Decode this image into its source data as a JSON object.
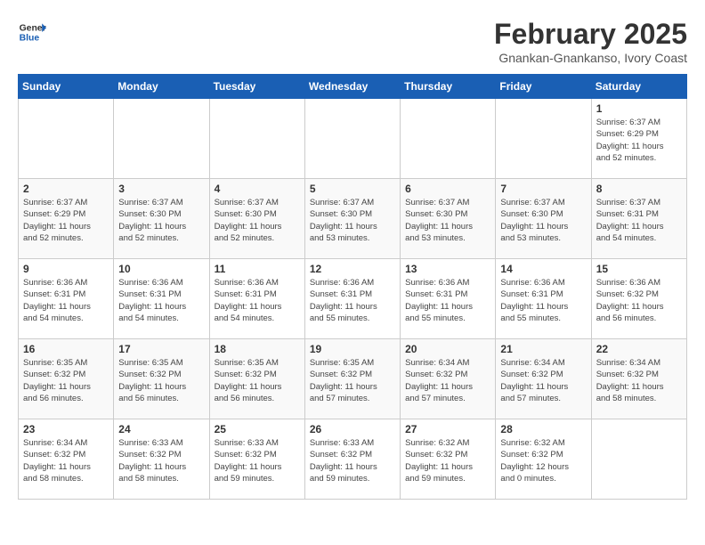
{
  "header": {
    "logo_line1": "General",
    "logo_line2": "Blue",
    "month": "February 2025",
    "location": "Gnankan-Gnankanso, Ivory Coast"
  },
  "days_of_week": [
    "Sunday",
    "Monday",
    "Tuesday",
    "Wednesday",
    "Thursday",
    "Friday",
    "Saturday"
  ],
  "weeks": [
    [
      {
        "day": "",
        "info": ""
      },
      {
        "day": "",
        "info": ""
      },
      {
        "day": "",
        "info": ""
      },
      {
        "day": "",
        "info": ""
      },
      {
        "day": "",
        "info": ""
      },
      {
        "day": "",
        "info": ""
      },
      {
        "day": "1",
        "info": "Sunrise: 6:37 AM\nSunset: 6:29 PM\nDaylight: 11 hours\nand 52 minutes."
      }
    ],
    [
      {
        "day": "2",
        "info": "Sunrise: 6:37 AM\nSunset: 6:29 PM\nDaylight: 11 hours\nand 52 minutes."
      },
      {
        "day": "3",
        "info": "Sunrise: 6:37 AM\nSunset: 6:30 PM\nDaylight: 11 hours\nand 52 minutes."
      },
      {
        "day": "4",
        "info": "Sunrise: 6:37 AM\nSunset: 6:30 PM\nDaylight: 11 hours\nand 52 minutes."
      },
      {
        "day": "5",
        "info": "Sunrise: 6:37 AM\nSunset: 6:30 PM\nDaylight: 11 hours\nand 53 minutes."
      },
      {
        "day": "6",
        "info": "Sunrise: 6:37 AM\nSunset: 6:30 PM\nDaylight: 11 hours\nand 53 minutes."
      },
      {
        "day": "7",
        "info": "Sunrise: 6:37 AM\nSunset: 6:30 PM\nDaylight: 11 hours\nand 53 minutes."
      },
      {
        "day": "8",
        "info": "Sunrise: 6:37 AM\nSunset: 6:31 PM\nDaylight: 11 hours\nand 54 minutes."
      }
    ],
    [
      {
        "day": "9",
        "info": "Sunrise: 6:36 AM\nSunset: 6:31 PM\nDaylight: 11 hours\nand 54 minutes."
      },
      {
        "day": "10",
        "info": "Sunrise: 6:36 AM\nSunset: 6:31 PM\nDaylight: 11 hours\nand 54 minutes."
      },
      {
        "day": "11",
        "info": "Sunrise: 6:36 AM\nSunset: 6:31 PM\nDaylight: 11 hours\nand 54 minutes."
      },
      {
        "day": "12",
        "info": "Sunrise: 6:36 AM\nSunset: 6:31 PM\nDaylight: 11 hours\nand 55 minutes."
      },
      {
        "day": "13",
        "info": "Sunrise: 6:36 AM\nSunset: 6:31 PM\nDaylight: 11 hours\nand 55 minutes."
      },
      {
        "day": "14",
        "info": "Sunrise: 6:36 AM\nSunset: 6:31 PM\nDaylight: 11 hours\nand 55 minutes."
      },
      {
        "day": "15",
        "info": "Sunrise: 6:36 AM\nSunset: 6:32 PM\nDaylight: 11 hours\nand 56 minutes."
      }
    ],
    [
      {
        "day": "16",
        "info": "Sunrise: 6:35 AM\nSunset: 6:32 PM\nDaylight: 11 hours\nand 56 minutes."
      },
      {
        "day": "17",
        "info": "Sunrise: 6:35 AM\nSunset: 6:32 PM\nDaylight: 11 hours\nand 56 minutes."
      },
      {
        "day": "18",
        "info": "Sunrise: 6:35 AM\nSunset: 6:32 PM\nDaylight: 11 hours\nand 56 minutes."
      },
      {
        "day": "19",
        "info": "Sunrise: 6:35 AM\nSunset: 6:32 PM\nDaylight: 11 hours\nand 57 minutes."
      },
      {
        "day": "20",
        "info": "Sunrise: 6:34 AM\nSunset: 6:32 PM\nDaylight: 11 hours\nand 57 minutes."
      },
      {
        "day": "21",
        "info": "Sunrise: 6:34 AM\nSunset: 6:32 PM\nDaylight: 11 hours\nand 57 minutes."
      },
      {
        "day": "22",
        "info": "Sunrise: 6:34 AM\nSunset: 6:32 PM\nDaylight: 11 hours\nand 58 minutes."
      }
    ],
    [
      {
        "day": "23",
        "info": "Sunrise: 6:34 AM\nSunset: 6:32 PM\nDaylight: 11 hours\nand 58 minutes."
      },
      {
        "day": "24",
        "info": "Sunrise: 6:33 AM\nSunset: 6:32 PM\nDaylight: 11 hours\nand 58 minutes."
      },
      {
        "day": "25",
        "info": "Sunrise: 6:33 AM\nSunset: 6:32 PM\nDaylight: 11 hours\nand 59 minutes."
      },
      {
        "day": "26",
        "info": "Sunrise: 6:33 AM\nSunset: 6:32 PM\nDaylight: 11 hours\nand 59 minutes."
      },
      {
        "day": "27",
        "info": "Sunrise: 6:32 AM\nSunset: 6:32 PM\nDaylight: 11 hours\nand 59 minutes."
      },
      {
        "day": "28",
        "info": "Sunrise: 6:32 AM\nSunset: 6:32 PM\nDaylight: 12 hours\nand 0 minutes."
      },
      {
        "day": "",
        "info": ""
      }
    ]
  ]
}
